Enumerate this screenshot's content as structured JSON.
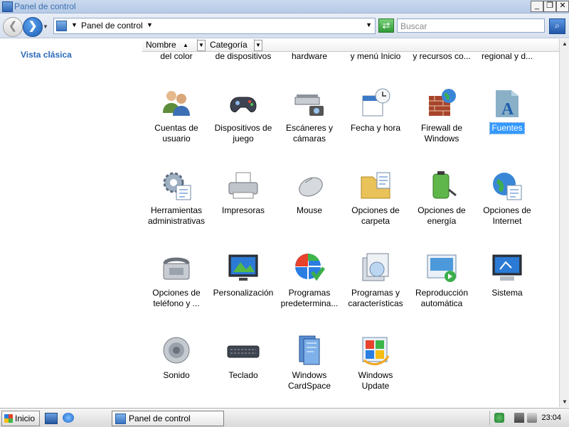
{
  "window": {
    "title": "Panel de control"
  },
  "address": {
    "crumb": "Panel de control"
  },
  "search": {
    "placeholder": "Buscar"
  },
  "left_pane": {
    "classic_view_link": "Vista clásica"
  },
  "columns": [
    {
      "label": "Nombre"
    },
    {
      "label": "Categoría"
    }
  ],
  "items": [
    {
      "label": "Administración del color",
      "icon": "color-management-icon"
    },
    {
      "label": "Administrador de dispositivos",
      "icon": "device-manager-icon"
    },
    {
      "label": "Agregar hardware",
      "icon": "add-hardware-icon"
    },
    {
      "label": "Barra de tareas y menú Inicio",
      "icon": "taskbar-icon"
    },
    {
      "label": "Centro de redes y recursos co...",
      "icon": "network-center-icon"
    },
    {
      "label": "Configuración regional y d...",
      "icon": "regional-settings-icon"
    },
    {
      "label": "Cuentas de usuario",
      "icon": "user-accounts-icon"
    },
    {
      "label": "Dispositivos de juego",
      "icon": "gamepad-icon"
    },
    {
      "label": "Escáneres y cámaras",
      "icon": "scanner-camera-icon"
    },
    {
      "label": "Fecha y hora",
      "icon": "date-time-icon"
    },
    {
      "label": "Firewall de Windows",
      "icon": "firewall-icon"
    },
    {
      "label": "Fuentes",
      "icon": "fonts-icon",
      "selected": true
    },
    {
      "label": "Herramientas administrativas",
      "icon": "admin-tools-icon"
    },
    {
      "label": "Impresoras",
      "icon": "printer-icon"
    },
    {
      "label": "Mouse",
      "icon": "mouse-icon"
    },
    {
      "label": "Opciones de carpeta",
      "icon": "folder-options-icon"
    },
    {
      "label": "Opciones de energía",
      "icon": "power-options-icon"
    },
    {
      "label": "Opciones de Internet",
      "icon": "internet-options-icon"
    },
    {
      "label": "Opciones de teléfono y ...",
      "icon": "phone-options-icon"
    },
    {
      "label": "Personalización",
      "icon": "personalization-icon"
    },
    {
      "label": "Programas predetermina...",
      "icon": "default-programs-icon"
    },
    {
      "label": "Programas y características",
      "icon": "programs-features-icon"
    },
    {
      "label": "Reproducción automática",
      "icon": "autoplay-icon"
    },
    {
      "label": "Sistema",
      "icon": "system-icon"
    },
    {
      "label": "Sonido",
      "icon": "sound-icon"
    },
    {
      "label": "Teclado",
      "icon": "keyboard-icon"
    },
    {
      "label": "Windows CardSpace",
      "icon": "cardspace-icon"
    },
    {
      "label": "Windows Update",
      "icon": "windows-update-icon"
    }
  ],
  "taskbar": {
    "start_label": "Inicio",
    "task_label": "Panel de control",
    "clock": "23:04"
  },
  "colors": {
    "link": "#2a6ab8",
    "selection": "#3399ff",
    "title_text": "#3b6fb0"
  }
}
